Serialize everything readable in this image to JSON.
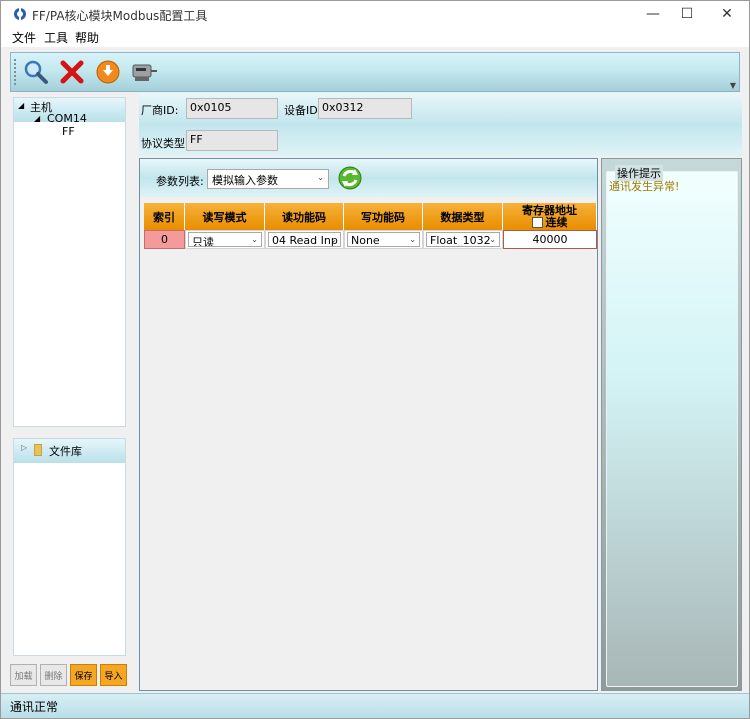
{
  "window": {
    "title": "FF/PA核心模块Modbus配置工具",
    "controls": {
      "minimize": "—",
      "maximize": "☐",
      "close": "✕"
    }
  },
  "menu": {
    "items": [
      "文件",
      "工具",
      "帮助"
    ]
  },
  "toolbar": {
    "buttons": [
      "search-icon",
      "delete-icon",
      "download-icon",
      "connect-icon"
    ]
  },
  "tree": {
    "root": "主机",
    "port": "COM14",
    "device": "FF",
    "expand_glyph": "◢"
  },
  "file_library": {
    "label": "文件库",
    "expand_glyph": "▷"
  },
  "left_buttons": {
    "add": "加载",
    "delete": "删除",
    "save": "保存",
    "import": "导入"
  },
  "device_info": {
    "vendor_label": "厂商ID:",
    "vendor_value": "0x0105",
    "device_label": "设备ID:",
    "device_value": "0x0312",
    "protocol_label": "协议类型:",
    "protocol_value": "FF"
  },
  "params": {
    "list_label": "参数列表:",
    "list_value": "模拟输入参数",
    "columns": [
      "索引",
      "读写模式",
      "读功能码",
      "写功能码",
      "数据类型",
      "寄存器地址"
    ],
    "continuous_label": "连续",
    "rows": [
      {
        "index": "0",
        "rw_mode": "只读",
        "read_code": "04 Read Inp",
        "write_code": "None",
        "data_type": "Float_1032",
        "register": "40000"
      }
    ]
  },
  "hint": {
    "title": "操作提示",
    "message": "通讯发生异常!"
  },
  "status": {
    "text": "通讯正常"
  },
  "colors": {
    "header_orange": "#f5a623",
    "index_red": "#f59a9a",
    "hint_text": "#a07a00"
  }
}
